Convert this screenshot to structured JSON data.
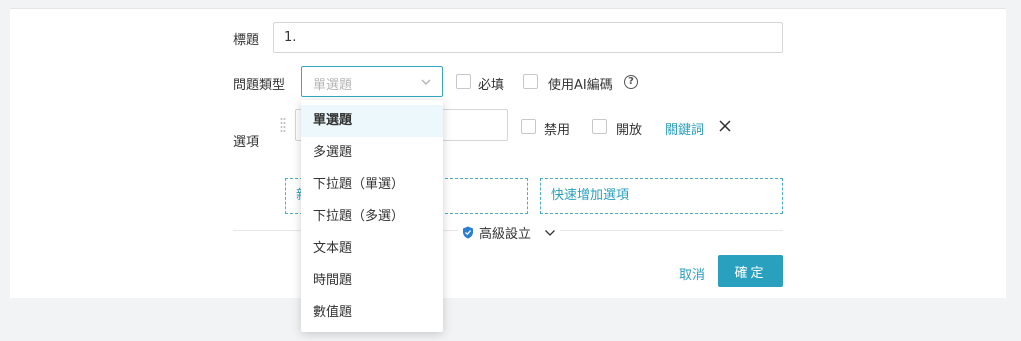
{
  "form": {
    "title_label": "標題",
    "title_value": "1.",
    "type_label": "問題類型",
    "type_selected": "單選題",
    "required_label": "必填",
    "ai_code_label": "使用AI編碼",
    "help_icon_glyph": "?",
    "options_label": "選項",
    "disable_label": "禁用",
    "open_label": "開放",
    "keyword_link": "關鍵詞",
    "add_option_partial": "新",
    "quick_add_label": "快速增加選項",
    "advanced_label": "高級設立",
    "cancel_label": "取消",
    "confirm_label": "確定"
  },
  "dropdown": {
    "options": [
      "單選題",
      "多選題",
      "下拉題（單選）",
      "下拉題（多選）",
      "文本題",
      "時間題",
      "數值題"
    ],
    "selected_index": 0
  },
  "colors": {
    "accent": "#2aa0bf",
    "focus_border": "#35a8c2",
    "selected_bg": "#ecf8fb"
  }
}
